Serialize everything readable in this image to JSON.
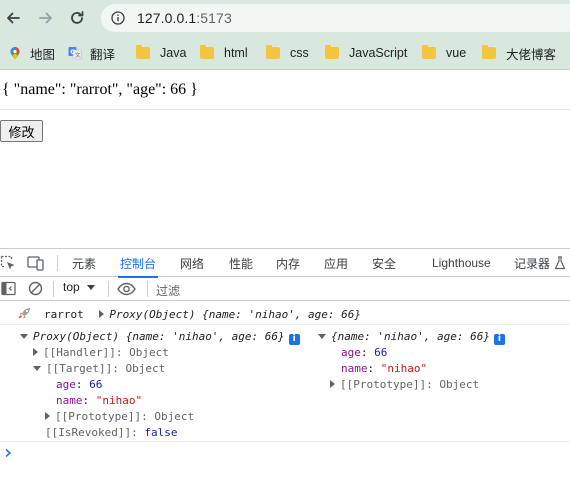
{
  "browser": {
    "url_host": "127.0.0.1",
    "url_port": ":5173",
    "bookmarks": [
      {
        "label": "地图",
        "icon": "maps-pin-icon"
      },
      {
        "label": "翻译",
        "icon": "translate-icon"
      },
      {
        "label": "Java",
        "icon": "folder-icon"
      },
      {
        "label": "html",
        "icon": "folder-icon"
      },
      {
        "label": "css",
        "icon": "folder-icon"
      },
      {
        "label": "JavaScript",
        "icon": "folder-icon"
      },
      {
        "label": "vue",
        "icon": "folder-icon"
      },
      {
        "label": "大佬博客",
        "icon": "folder-icon"
      }
    ]
  },
  "page": {
    "json_text": "{ \"name\": \"rarrot\", \"age\": 66 }",
    "modify_button": "修改"
  },
  "devtools": {
    "tabs": [
      "元素",
      "控制台",
      "网络",
      "性能",
      "内存",
      "应用",
      "安全",
      "Lighthouse",
      "记录器"
    ],
    "active_tab": "控制台",
    "context": "top",
    "filter_placeholder": "过滤",
    "console": {
      "line1_label": "rarrot",
      "line1_proxy": "Proxy(Object)",
      "line1_preview": "{name: 'nihao', age: 66}",
      "proxy_header": "Proxy(Object)",
      "proxy_preview": "{name: 'nihao', age: 66}",
      "handler": "[[Handler]]: Object",
      "target": "[[Target]]: Object",
      "age_key": "age",
      "age_val": "66",
      "name_key": "name",
      "name_val": "\"nihao\"",
      "prototype": "[[Prototype]]: Object",
      "revoked_key": "[[IsRevoked]]",
      "revoked_val": "false",
      "obj_preview": "{name: 'nihao', age: 66}"
    }
  }
}
